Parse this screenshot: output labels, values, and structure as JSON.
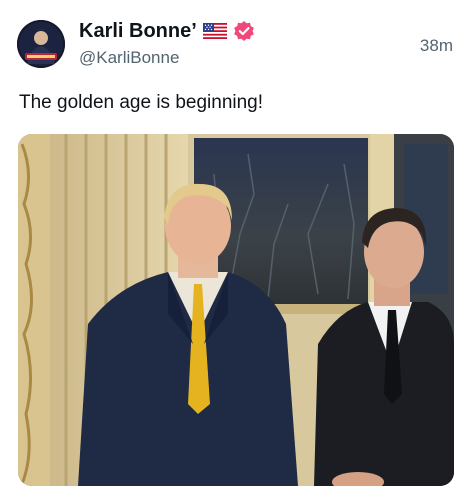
{
  "author": {
    "display_name": "Karli Bonne’",
    "handle": "@KarliBonne",
    "flag_icon": "us-flag-icon",
    "verified_icon": "verified-badge-icon",
    "avatar_icon": "avatar-image"
  },
  "post": {
    "timestamp": "38m",
    "text": "The golden age is beginning!"
  },
  "media": {
    "kind": "video-still",
    "icon": "video-thumbnail-image"
  },
  "colors": {
    "text_primary": "#0f1419",
    "text_secondary": "#536471",
    "verified_badge": "#f0487a"
  }
}
